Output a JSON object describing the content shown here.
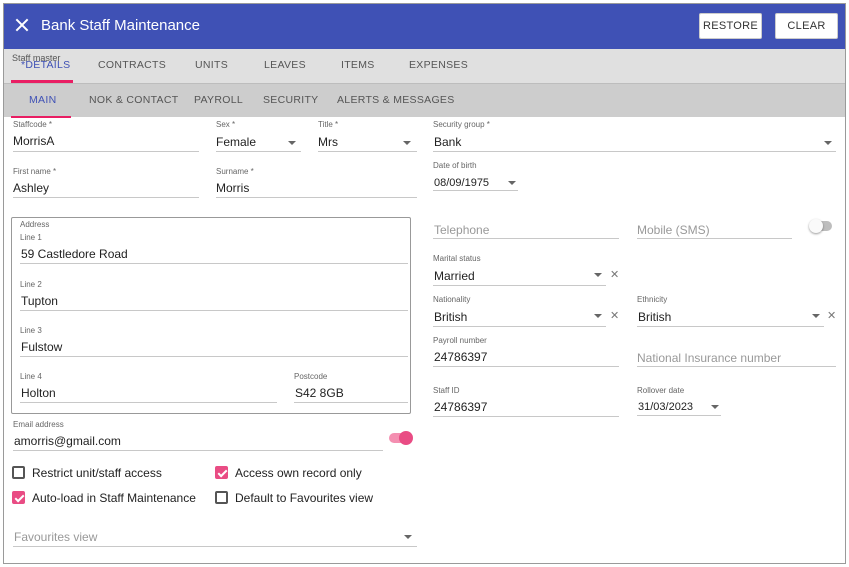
{
  "header": {
    "title": "Bank Staff Maintenance",
    "restore_label": "RESTORE",
    "clear_label": "CLEAR"
  },
  "tabs1": {
    "crumb": "Staff master",
    "items": [
      "*DETAILS",
      "CONTRACTS",
      "UNITS",
      "LEAVES",
      "ITEMS",
      "EXPENSES"
    ]
  },
  "tabs2": {
    "items": [
      "MAIN",
      "NOK & CONTACT",
      "PAYROLL",
      "SECURITY",
      "ALERTS & MESSAGES"
    ]
  },
  "form": {
    "staffcode": {
      "label": "Staffcode *",
      "value": "MorrisA"
    },
    "sex": {
      "label": "Sex *",
      "value": "Female"
    },
    "title": {
      "label": "Title *",
      "value": "Mrs"
    },
    "security_group": {
      "label": "Security group *",
      "value": "Bank"
    },
    "first_name": {
      "label": "First name *",
      "value": "Ashley"
    },
    "surname": {
      "label": "Surname *",
      "value": "Morris"
    },
    "dob": {
      "label": "Date of birth",
      "value": "08/09/1975"
    },
    "address": {
      "legend": "Address",
      "line1": {
        "label": "Line 1",
        "value": "59 Castledore Road"
      },
      "line2": {
        "label": "Line 2",
        "value": "Tupton"
      },
      "line3": {
        "label": "Line 3",
        "value": "Fulstow"
      },
      "line4": {
        "label": "Line 4",
        "value": "Holton"
      },
      "postcode": {
        "label": "Postcode",
        "value": "S42 8GB"
      }
    },
    "email": {
      "label": "Email address",
      "value": "amorris@gmail.com"
    },
    "telephone": {
      "placeholder": "Telephone"
    },
    "mobile": {
      "placeholder": "Mobile (SMS)"
    },
    "marital": {
      "label": "Marital status",
      "value": "Married"
    },
    "nationality": {
      "label": "Nationality",
      "value": "British"
    },
    "ethnicity": {
      "label": "Ethnicity",
      "value": "British"
    },
    "payroll": {
      "label": "Payroll number",
      "value": "24786397"
    },
    "ni": {
      "placeholder": "National Insurance number"
    },
    "staff_id": {
      "label": "Staff ID",
      "value": "24786397"
    },
    "rollover": {
      "label": "Rollover date",
      "value": "31/03/2023"
    },
    "favourites": {
      "placeholder": "Favourites view"
    },
    "clear_glyph": "✕"
  },
  "checks": {
    "restrict": "Restrict unit/staff access",
    "own_record": "Access own record only",
    "autoload": "Auto-load in Staff Maintenance",
    "favourites_default": "Default to Favourites view"
  },
  "colors": {
    "header": "#3f51b5",
    "accent": "#e91e63",
    "checkbox": "#e94c84"
  },
  "icons": {
    "close": "close-icon",
    "dropdown": "chevron-down-icon",
    "clear": "clear-icon"
  }
}
